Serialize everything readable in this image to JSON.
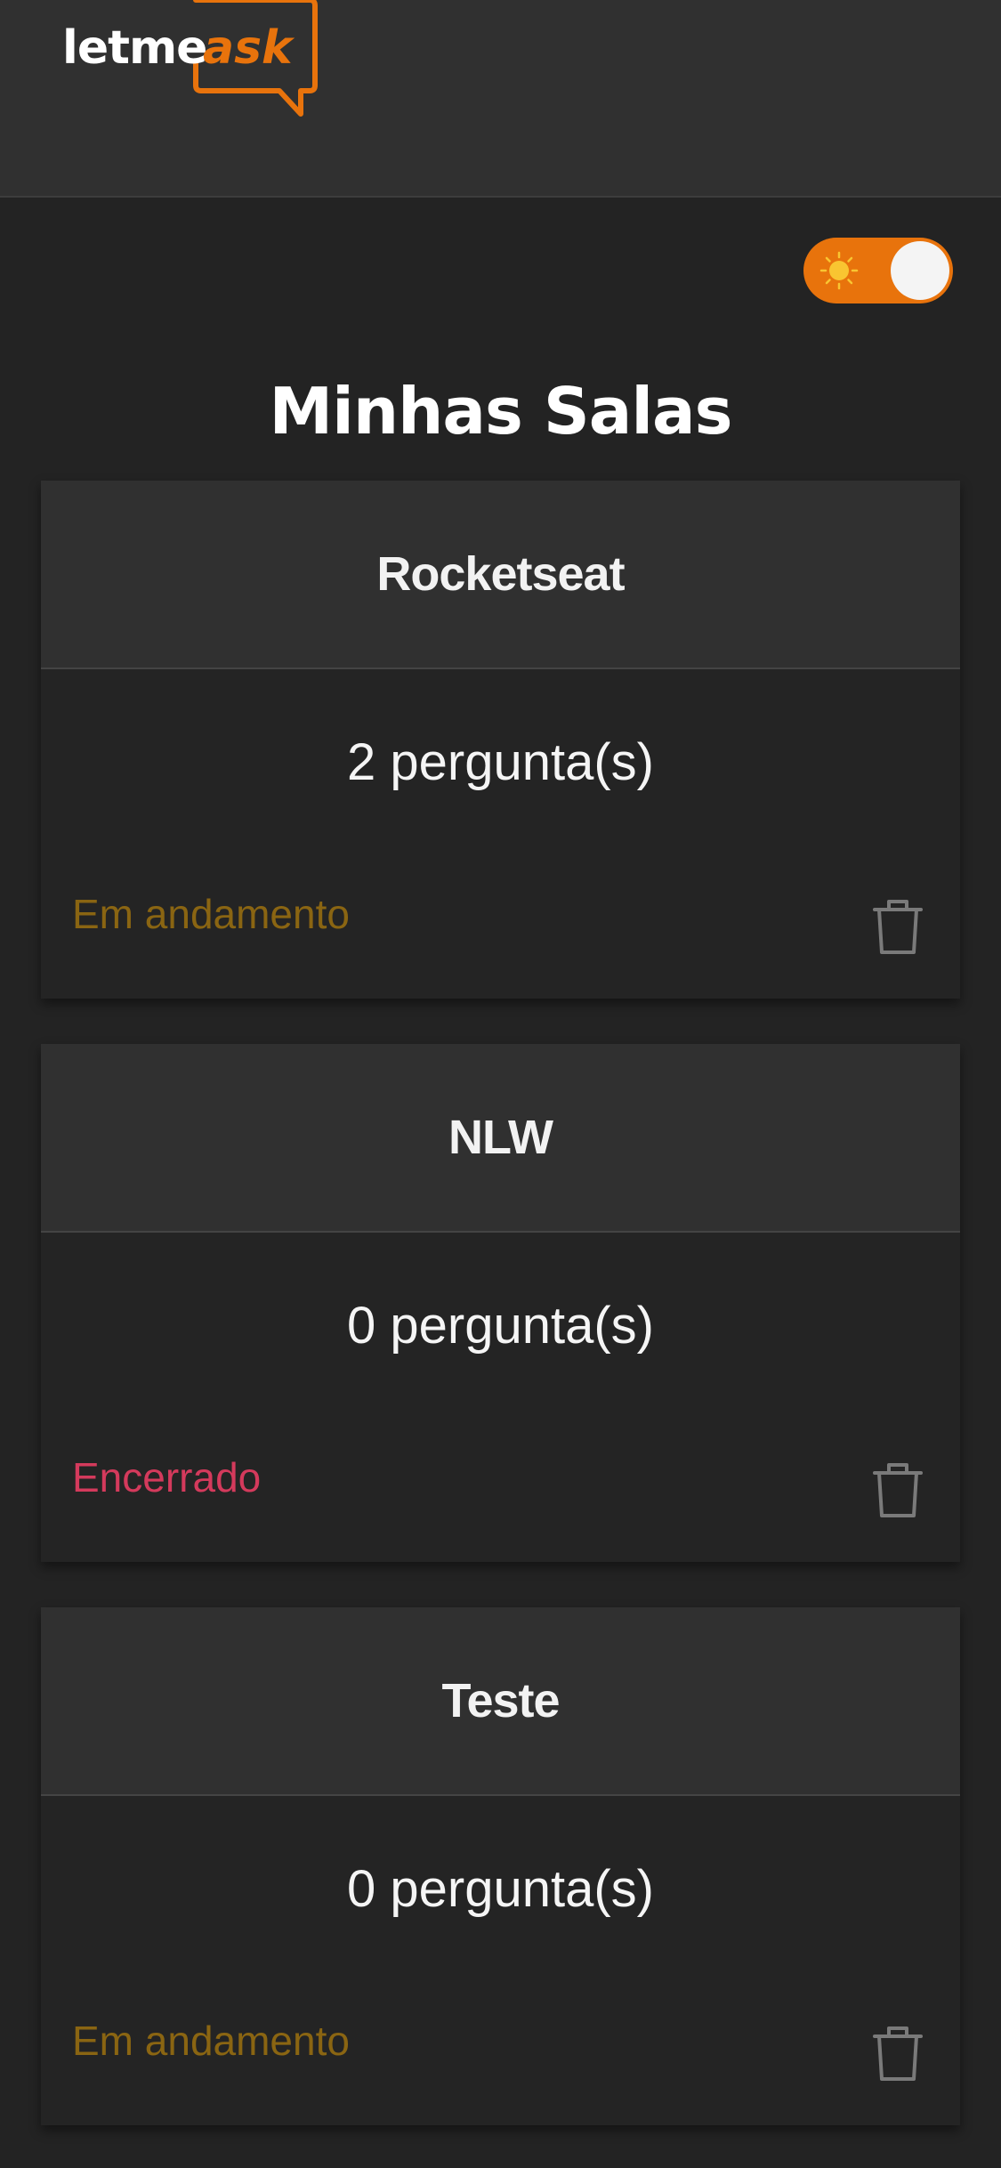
{
  "header": {
    "logo_primary": "letme",
    "logo_accent": "ask"
  },
  "theme_toggle": {
    "state": "light",
    "icon": "sun-icon"
  },
  "page": {
    "title": "Minhas Salas"
  },
  "rooms": [
    {
      "name": "Rocketseat",
      "questions": "2 pergunta(s)",
      "status": "Em andamento",
      "status_kind": "open"
    },
    {
      "name": "NLW",
      "questions": "0 pergunta(s)",
      "status": "Encerrado",
      "status_kind": "closed"
    },
    {
      "name": "Teste",
      "questions": "0 pergunta(s)",
      "status": "Em andamento",
      "status_kind": "open"
    }
  ],
  "colors": {
    "brand_orange": "#e8730c",
    "status_open": "#8a6512",
    "status_closed": "#d43a5c"
  }
}
